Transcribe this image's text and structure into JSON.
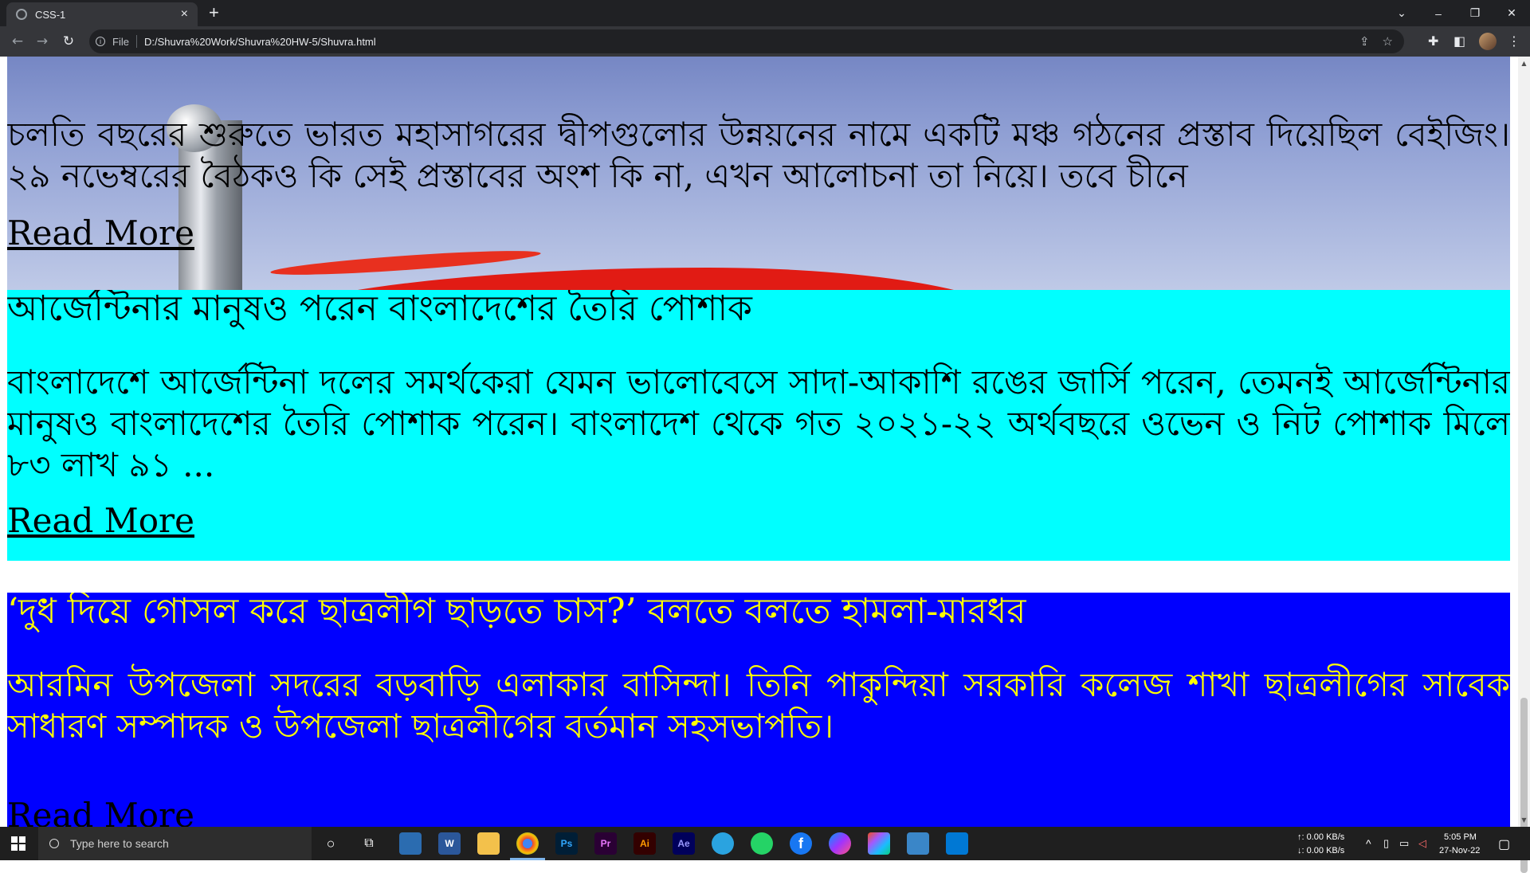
{
  "browser": {
    "tab_title": "CSS-1",
    "tab_close": "×",
    "new_tab": "+",
    "url_scheme": "File",
    "url": "D:/Shuvra%20Work/Shuvra%20HW-5/Shuvra.html",
    "controls": {
      "dropdown": "⌄",
      "minimize": "–",
      "restore": "❐",
      "close": "✕"
    }
  },
  "articles": [
    {
      "title": "",
      "body": "চলতি বছরের শুরুতে ভারত মহাসাগরের দ্বীপগুলোর উন্নয়নের নামে একটি মঞ্চ গঠনের প্রস্তাব দিয়েছিল বেইজিং। ২৯ নভেম্বরের বৈঠকও কি সেই প্রস্তাবের অংশ কি না, এখন আলোচনা তা নিয়ে। তবে চীনে",
      "read_more": "Read More"
    },
    {
      "title": "আর্জেন্টিনার মানুষও পরেন বাংলাদেশের তৈরি পোশাক",
      "body": "বাংলাদেশে আর্জেন্টিনা দলের সমর্থকেরা যেমন ভালোবেসে সাদা-আকাশি রঙের জার্সি পরেন, তেমনই আর্জেন্টিনার মানুষও বাংলাদেশের তৈরি পোশাক পরেন। বাংলাদেশ থেকে গত ২০২১-২২ অর্থবছরে ওভেন ও নিট পোশাক মিলে ৮৩ লাখ ৯১ ...",
      "read_more": "Read More",
      "background": "#00ffff",
      "text_color": "#000000"
    },
    {
      "title": "‘দুধ দিয়ে গোসল করে ছাত্রলীগ ছাড়তে চাস?’ বলতে বলতে হামলা-মারধর",
      "body": "আরমিন উপজেলা সদরের বড়বাড়ি এলাকার বাসিন্দা। তিনি পাকুন্দিয়া সরকারি কলেজ শাখা ছাত্রলীগের সাবেক সাধারণ সম্পাদক ও উপজেলা ছাত্রলীগের বর্তমান সহসভাপতি।",
      "read_more": "Read More",
      "background": "#0000ff",
      "text_color": "#ffff00"
    }
  ],
  "taskbar": {
    "search_placeholder": "Type here to search",
    "apps": [
      "Ps",
      "Pr",
      "Ai",
      "Ae"
    ],
    "net_up": "↑: 0.00 KB/s",
    "net_down": "↓: 0.00 KB/s",
    "time": "5:05 PM",
    "date": "27-Nov-22"
  }
}
